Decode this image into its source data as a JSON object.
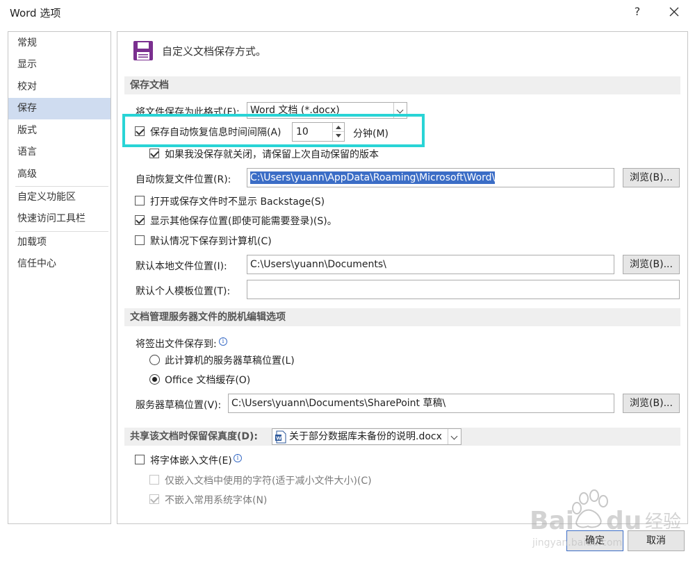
{
  "window": {
    "title": "Word 选项",
    "help": "?"
  },
  "sidebar": {
    "items": [
      {
        "label": "常规"
      },
      {
        "label": "显示"
      },
      {
        "label": "校对"
      },
      {
        "label": "保存",
        "active": true
      },
      {
        "label": "版式"
      },
      {
        "label": "语言"
      },
      {
        "label": "高级"
      },
      {
        "label": "自定义功能区"
      },
      {
        "label": "快速访问工具栏"
      },
      {
        "label": "加载项"
      },
      {
        "label": "信任中心"
      }
    ]
  },
  "header": {
    "title": "自定义文档保存方式。",
    "icon": "floppy-disk-icon"
  },
  "save_docs": {
    "section_title": "保存文档",
    "format_label": "将文件保存为此格式(F):",
    "format_value": "Word 文档 (*.docx)",
    "autorecover_label": "保存自动恢复信息时间间隔(A)",
    "autorecover_checked": true,
    "autorecover_minutes": "10",
    "minutes_label": "分钟(M)",
    "keep_last_label": "如果我没保存就关闭，请保留上次自动保留的版本",
    "keep_last_checked": true,
    "autorecover_path_label": "自动恢复文件位置(R):",
    "autorecover_path": "C:\\Users\\yuann\\AppData\\Roaming\\Microsoft\\Word\\",
    "browse_label": "浏览(B)...",
    "no_backstage_label": "打开或保存文件时不显示 Backstage(S)",
    "no_backstage_checked": false,
    "show_other_label": "显示其他保存位置(即使可能需要登录)(S)。",
    "show_other_checked": true,
    "save_to_computer_label": "默认情况下保存到计算机(C)",
    "save_to_computer_checked": false,
    "local_path_label": "默认本地文件位置(I):",
    "local_path": "C:\\Users\\yuann\\Documents\\",
    "template_path_label": "默认个人模板位置(T):",
    "template_path": ""
  },
  "offline": {
    "section_title": "文档管理服务器文件的脱机编辑选项",
    "checkout_label": "将签出文件保存到:",
    "option_server_drafts": "此计算机的服务器草稿位置(L)",
    "option_office_cache": "Office 文档缓存(O)",
    "selected": "office_cache",
    "drafts_label": "服务器草稿位置(V):",
    "drafts_path": "C:\\Users\\yuann\\Documents\\SharePoint 草稿\\",
    "browse_label": "浏览(B)..."
  },
  "fidelity": {
    "section_title": "共享该文档时保留保真度(D):",
    "document": "关于部分数据库未备份的说明.docx",
    "embed_fonts_label": "将字体嵌入文件(E)",
    "embed_fonts_checked": false,
    "embed_used_label": "仅嵌入文档中使用的字符(适于减小文件大小)(C)",
    "embed_used_checked": false,
    "no_common_label": "不嵌入常用系统字体(N)",
    "no_common_checked": true
  },
  "footer": {
    "ok_label": "确定",
    "cancel_label": "取消"
  },
  "colors": {
    "highlight": "#29d4d6",
    "accent": "#7a2f8f",
    "selection": "#3b6dc6",
    "active_nav": "#cfdcf0"
  }
}
